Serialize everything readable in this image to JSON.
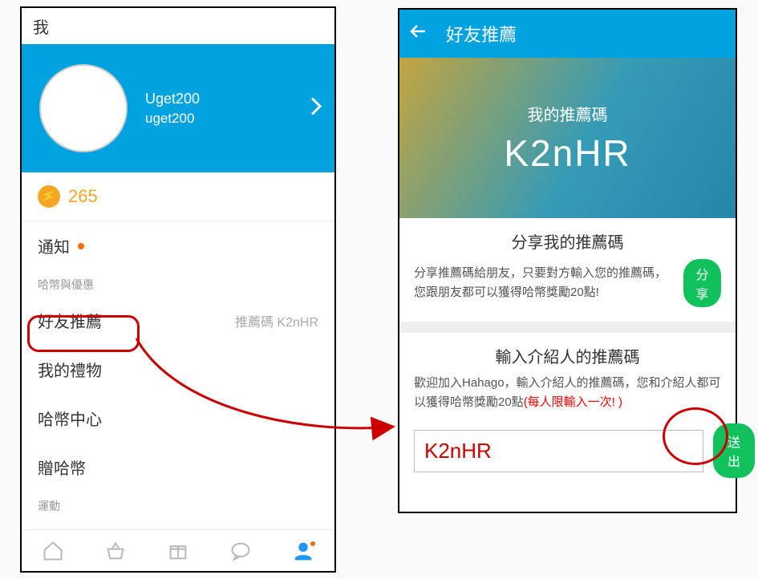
{
  "phoneA": {
    "title": "我",
    "username": "Uget200",
    "userid": "uget200",
    "coins": "265",
    "notif": "通知",
    "sectionCoins": "哈幣與優惠",
    "rows": {
      "refer": {
        "label": "好友推薦",
        "sub": "推薦碼 K2nHR"
      },
      "gifts": "我的禮物",
      "center": "哈幣中心",
      "give": "贈哈幣"
    },
    "sectionSport": "運動"
  },
  "phoneB": {
    "headerTitle": "好友推薦",
    "heroLabel": "我的推薦碼",
    "heroCode": "K2nHR",
    "share": {
      "title": "分享我的推薦碼",
      "body": "分享推薦碼給朋友，只要對方輸入您的推薦碼，您跟朋友都可以獲得哈幣獎勵20點!",
      "button": "分享"
    },
    "enter": {
      "title": "輸入介紹人的推薦碼",
      "body": "歡迎加入Hahago，輸入介紹人的推薦碼，您和介紹人都可以獲得哈幣獎勵20點",
      "warn": "(每人限輸入一次! )",
      "value": "K2nHR",
      "button": "送出"
    }
  }
}
